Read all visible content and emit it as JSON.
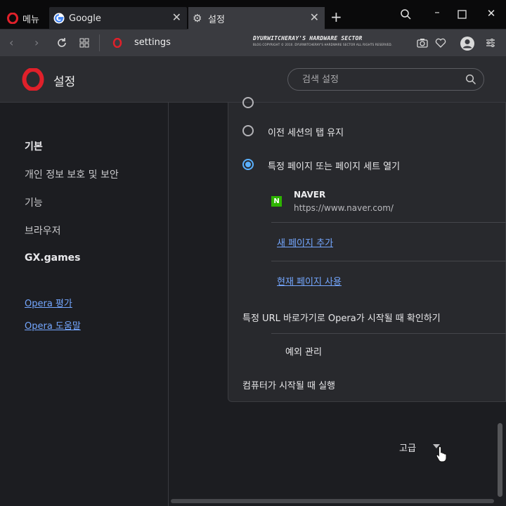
{
  "tabs": [
    {
      "label": "메뉴"
    },
    {
      "label": "Google"
    },
    {
      "label": "설정"
    }
  ],
  "address": {
    "url": "settings"
  },
  "banner": {
    "line1": "DYURWITCHERAY'S HARDWARE SECTOR",
    "line2": "BLOG COPYRIGHT © 2010. DYURWITCHERAY'S HARDWARE SECTOR ALL RIGHTS RESERVED."
  },
  "header": {
    "title": "설정",
    "search_placeholder": "검색 설정"
  },
  "sidebar": {
    "items": [
      "기본",
      "개인 정보 보호 및 보안",
      "기능",
      "브라우저",
      "GX.games"
    ],
    "links": [
      "Opera 평가",
      "Opera 도움말"
    ]
  },
  "startup": {
    "option_keep": "이전 세션의 탭 유지",
    "option_open": "특정 페이지 또는 페이지 세트 열기",
    "selected": "option_open",
    "page": {
      "name": "NAVER",
      "url": "https://www.naver.com/",
      "favicon_letter": "N"
    },
    "add_page": "새 페이지 추가",
    "use_current": "현재 페이지 사용",
    "url_shortcut": "특정 URL 바로가기로 Opera가 시작될 때 확인하기",
    "exceptions": "예외 관리",
    "run_on_startup": "컴퓨터가 시작될 때 실행"
  },
  "advanced": {
    "label": "고급"
  },
  "colors": {
    "accent": "#5ab0ff",
    "link": "#74a7ff",
    "opera_red": "#e0202a",
    "naver_green": "#2db400"
  }
}
